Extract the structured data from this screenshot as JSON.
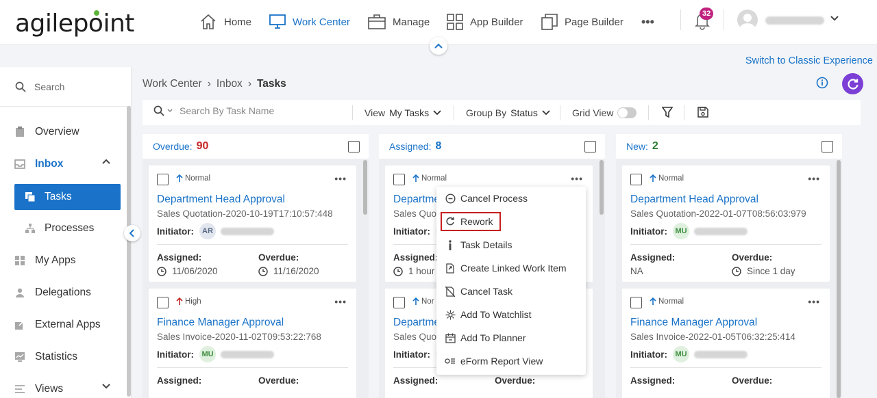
{
  "header": {
    "logo_text": "agilepoint",
    "nav": [
      {
        "label": "Home"
      },
      {
        "label": "Work Center"
      },
      {
        "label": "Manage"
      },
      {
        "label": "App Builder"
      },
      {
        "label": "Page Builder"
      }
    ],
    "more_label": "•••",
    "notification_count": "32",
    "classic_link": "Switch to Classic Experience"
  },
  "sidebar": {
    "search_placeholder": "Search",
    "items": [
      {
        "label": "Overview"
      },
      {
        "label": "Inbox"
      },
      {
        "label": "Tasks"
      },
      {
        "label": "Processes"
      },
      {
        "label": "My Apps"
      },
      {
        "label": "Delegations"
      },
      {
        "label": "External Apps"
      },
      {
        "label": "Statistics"
      },
      {
        "label": "Views"
      }
    ]
  },
  "breadcrumb": [
    "Work Center",
    "Inbox",
    "Tasks"
  ],
  "toolbar": {
    "search_placeholder": "Search By Task Name",
    "view_label": "View",
    "view_value": "My Tasks",
    "group_label": "Group By",
    "group_value": "Status",
    "grid_label": "Grid View"
  },
  "columns": [
    {
      "title": "Overdue:",
      "count": "90",
      "color": "#c62828",
      "cards": [
        {
          "priority": "Normal",
          "title": "Department Head Approval",
          "sub": "Sales Quotation-2020-10-19T17:10:57:448",
          "initiator_label": "Initiator:",
          "initials": "AR",
          "assigned_label": "Assigned:",
          "assigned": "11/06/2020",
          "overdue_label": "Overdue:",
          "overdue": "11/16/2020"
        },
        {
          "priority": "High",
          "title": "Finance Manager Approval",
          "sub": "Sales Invoice-2020-11-02T09:53:22:768",
          "initiator_label": "Initiator:",
          "initials": "MU",
          "assigned_label": "Assigned:",
          "overdue_label": "Overdue:"
        }
      ]
    },
    {
      "title": "Assigned:",
      "count": "8",
      "color": "#1a73c8",
      "cards": [
        {
          "priority": "Normal",
          "title": "Departme",
          "sub": "Sales Quota",
          "initiator_label": "Initiator:",
          "assigned_label": "Assigned:",
          "assigned": "1 hour"
        },
        {
          "priority": "Nor",
          "title": "Departme",
          "sub": "Sales Quot",
          "initiator_label": "Initiator:",
          "assigned_label": "Assigned:",
          "overdue_label": "Overdue:"
        }
      ]
    },
    {
      "title": "New:",
      "count": "2",
      "color": "#2e7d32",
      "cards": [
        {
          "priority": "Normal",
          "title": "Department Head Approval",
          "sub": "Sales Quotation-2022-01-07T08:56:03:979",
          "initiator_label": "Initiator:",
          "initials": "MU",
          "assigned_label": "Assigned:",
          "assigned": "NA",
          "overdue_label": "Overdue:",
          "overdue": "Since 1 day"
        },
        {
          "priority": "Normal",
          "title": "Finance Manager Approval",
          "sub": "Sales Invoice-2022-01-05T06:32:25:414",
          "initiator_label": "Initiator:",
          "initials": "MU",
          "assigned_label": "Assigned:",
          "overdue_label": "Overdue:"
        }
      ]
    }
  ],
  "context_menu": {
    "items": [
      {
        "label": "Cancel Process",
        "icon": "cancel-circle-icon"
      },
      {
        "label": "Rework",
        "icon": "rework-icon"
      },
      {
        "label": "Task Details",
        "icon": "info-icon"
      },
      {
        "label": "Create Linked Work Item",
        "icon": "linked-item-icon"
      },
      {
        "label": "Cancel Task",
        "icon": "cancel-task-icon"
      },
      {
        "label": "Add To Watchlist",
        "icon": "watchlist-icon"
      },
      {
        "label": "Add To Planner",
        "icon": "planner-icon"
      },
      {
        "label": "eForm Report View",
        "icon": "report-view-icon"
      }
    ]
  },
  "colors": {
    "accent": "#1a73c8",
    "refresh": "#7b3fd6",
    "badge": "#c0237f",
    "highlight": "#c61f1f"
  }
}
